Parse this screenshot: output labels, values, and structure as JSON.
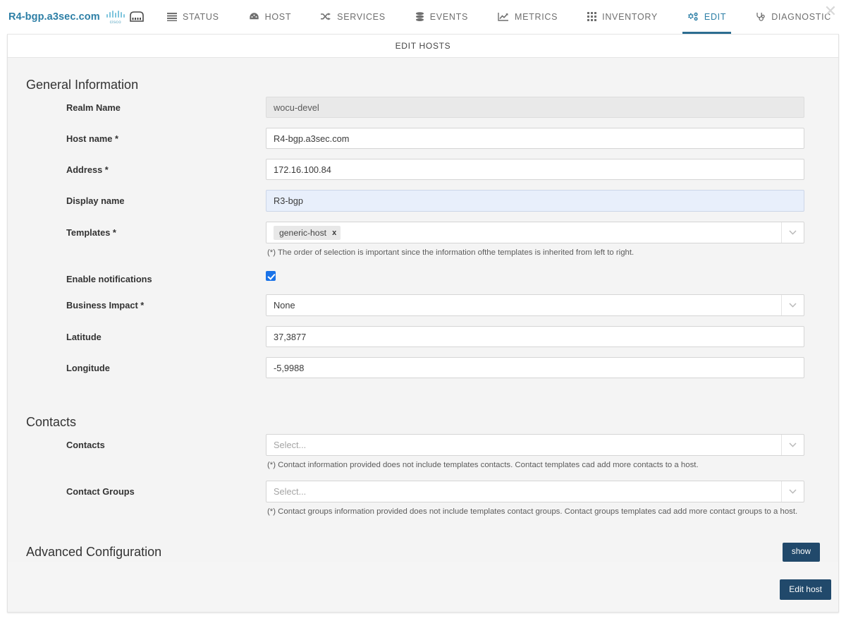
{
  "topbar": {
    "brand_name": "R4-bgp.a3sec.com",
    "cisco_label": "cisco",
    "close_label": "✕",
    "nav": [
      {
        "label": "STATUS",
        "icon": "list-icon",
        "active": false
      },
      {
        "label": "HOST",
        "icon": "gauge-icon",
        "active": false
      },
      {
        "label": "SERVICES",
        "icon": "shuffle-icon",
        "active": false
      },
      {
        "label": "EVENTS",
        "icon": "database-icon",
        "active": false
      },
      {
        "label": "METRICS",
        "icon": "chart-line-icon",
        "active": false
      },
      {
        "label": "INVENTORY",
        "icon": "grid-icon",
        "active": false
      },
      {
        "label": "EDIT",
        "icon": "cogs-icon",
        "active": true
      },
      {
        "label": "DIAGNOSTIC",
        "icon": "stethoscope-icon",
        "active": false
      }
    ]
  },
  "panel": {
    "header_title": "EDIT HOSTS"
  },
  "general": {
    "section_title": "General Information",
    "realm": {
      "label": "Realm Name",
      "value": "wocu-devel"
    },
    "hostname": {
      "label": "Host name *",
      "value": "R4-bgp.a3sec.com"
    },
    "address": {
      "label": "Address *",
      "value": "172.16.100.84"
    },
    "display_name": {
      "label": "Display name",
      "value": "R3-bgp"
    },
    "templates": {
      "label": "Templates *",
      "chips": [
        "generic-host"
      ],
      "chip_remove": "x",
      "hint": "(*) The order of selection is important since the information ofthe templates is inherited from left to right."
    },
    "notifications": {
      "label": "Enable notifications",
      "checked": true
    },
    "business_impact": {
      "label": "Business Impact *",
      "value": "None"
    },
    "latitude": {
      "label": "Latitude",
      "value": "37,3877"
    },
    "longitude": {
      "label": "Longitude",
      "value": "-5,9988"
    }
  },
  "contacts": {
    "section_title": "Contacts",
    "contacts": {
      "label": "Contacts",
      "placeholder": "Select...",
      "hint": "(*) Contact information provided does not include templates contacts. Contact templates cad add more contacts to a host."
    },
    "contact_groups": {
      "label": "Contact Groups",
      "placeholder": "Select...",
      "hint": "(*) Contact groups information provided does not include templates contact groups. Contact groups templates cad add more contact groups to a host."
    }
  },
  "advanced": {
    "title": "Advanced Configuration",
    "show_label": "show"
  },
  "footer": {
    "edit_host_label": "Edit host"
  },
  "colors": {
    "accent": "#2d7fa6",
    "button": "#21496b",
    "checkbox": "#1a73e8",
    "highlight_field": "#e8effb"
  }
}
